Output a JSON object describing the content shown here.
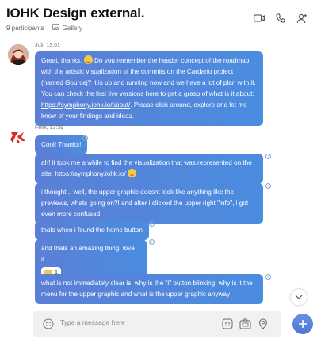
{
  "header": {
    "title": "IOHK Design external.",
    "participants": "9 participants",
    "separator": "|",
    "gallery": "Gallery"
  },
  "messages": [
    {
      "author": "Juli",
      "meta": "Juli, 13:01",
      "text_before": "Great, thanks.",
      "text_after": "Do you remember the header concept of the roadmap with the artistic visualization of the commits on the Cardano project (named Gourcej? it is up and running now and we have a lot of plan with it. You can check the first live versions here to get a grasp of what is it about:",
      "link": "https://symphony.iohk.io/about/",
      "text_tail": ". Please click around, explore and let me know of your findings and ideas."
    },
    {
      "author": "Felix",
      "meta": "Felix, 13:39",
      "text": "Cool! Thanks!"
    },
    {
      "text": "ah! it took me a while to find the visualization that was represented on the site:",
      "link": "https://symphony.iohk.io/"
    },
    {
      "text": "i thought... well, the upper graphic doesnt look like anything like the previews, whats going on?! and after i clicked the upper right \"info\", i got even more confused"
    },
    {
      "text": "thats when i found the home button"
    },
    {
      "text": "and thats an amazing thing. love it.",
      "reaction_count": "1"
    },
    {
      "text": "what is not immediately clear is, why is the \"i\" button blinking, why is it the menu for the upper graphic and what is the upper graphic anyway"
    }
  ],
  "composer": {
    "placeholder": "Type a message here"
  },
  "icons": {
    "video": "video-camera-icon",
    "call": "phone-icon",
    "add_user": "add-person-icon",
    "gallery": "gallery-icon",
    "emoji": "emoji-icon",
    "sticker": "sticker-icon",
    "attachment": "attachment-icon",
    "location": "location-pin-icon",
    "scroll_down": "chevron-down-icon",
    "new": "plus-icon"
  },
  "colors": {
    "bubble": "#5b7fd6",
    "accent": "#4d76d6",
    "juli_avatar": "#c0392b",
    "felix_avatar": "#d62b2b"
  }
}
